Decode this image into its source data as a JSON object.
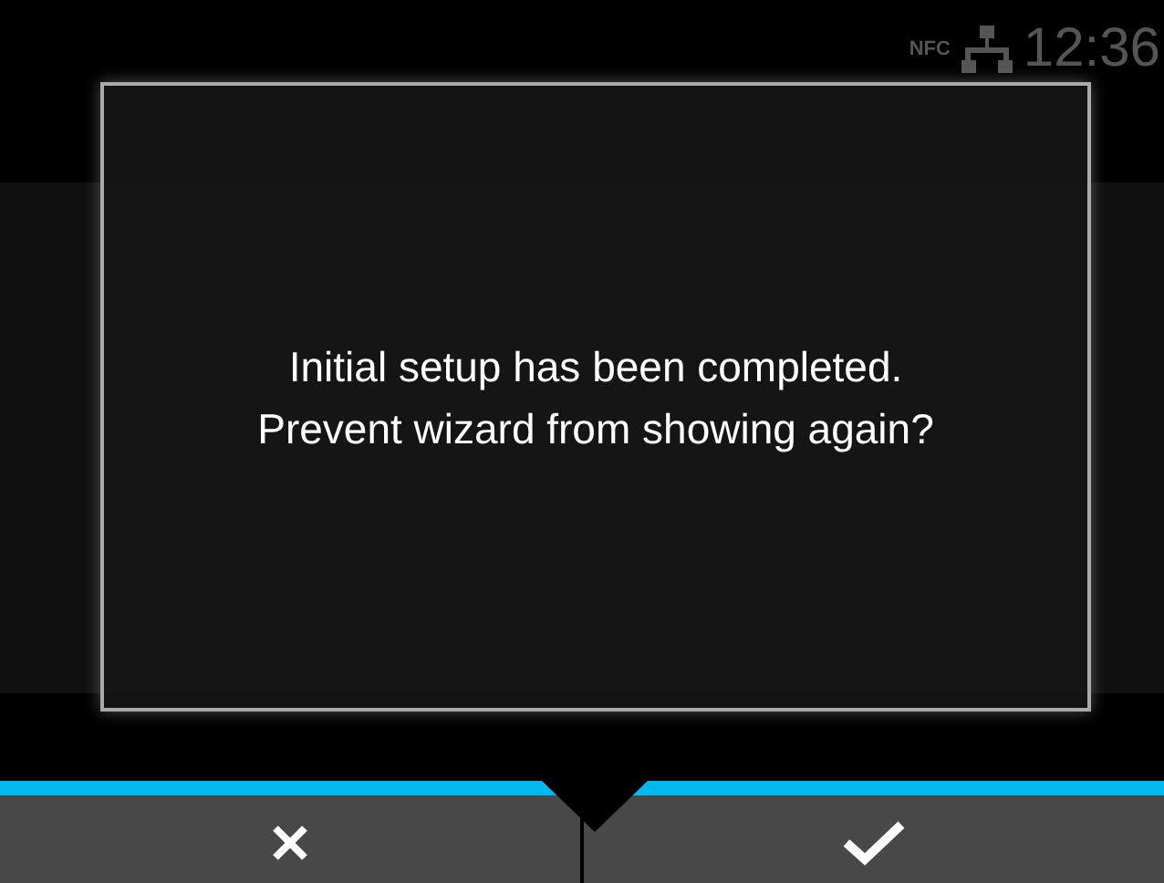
{
  "status_bar": {
    "nfc_label": "NFC",
    "time": "12:36"
  },
  "dialog": {
    "message_lines": [
      "Initial setup has been completed.",
      "Prevent wizard from showing again?"
    ]
  },
  "buttons": [
    {
      "kind": "cancel"
    },
    {
      "kind": "confirm"
    }
  ]
}
